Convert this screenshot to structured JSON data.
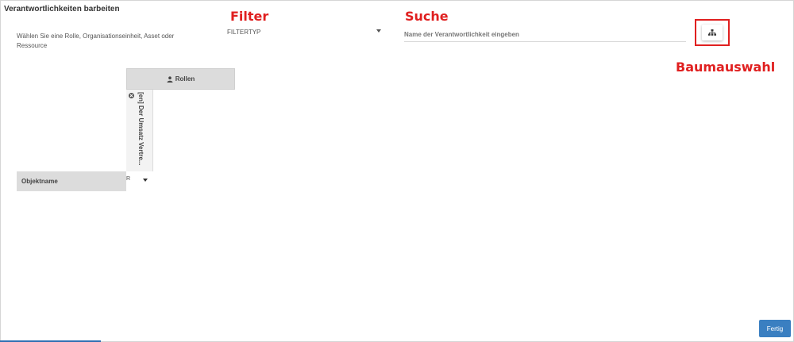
{
  "page": {
    "title": "Verantwortlichkeiten barbeiten"
  },
  "instruction": "Wählen Sie eine Rolle, Organisationseinheit, Asset oder Ressource",
  "annotations": {
    "filter": "Filter",
    "search": "Suche",
    "tree": "Baumauswahl",
    "color": "#e02020"
  },
  "filter": {
    "selected": "FILTERTYP",
    "icon": "caret-down-icon"
  },
  "search": {
    "placeholder": "Name der Verantwortlichkeit eingeben",
    "value": ""
  },
  "tree_button": {
    "icon": "sitemap-icon"
  },
  "matrix": {
    "roles_header": "Rollen",
    "roles_icon": "user-icon",
    "column_label": "[en] Der Umsatz Vertre...",
    "remove_icon": "remove-circle-icon",
    "row_header": "Objektname",
    "cell_value": "R"
  },
  "footer": {
    "done_label": "Fertig",
    "accent": "#3a7fc1"
  }
}
